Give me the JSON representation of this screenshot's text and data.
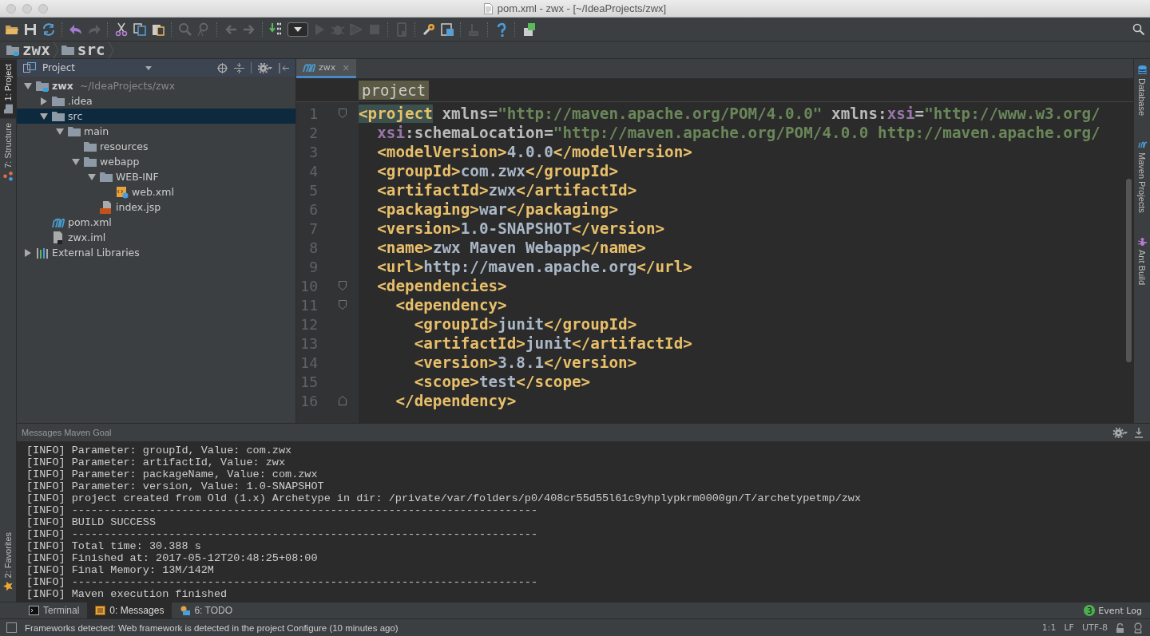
{
  "window": {
    "title": "pom.xml - zwx - [~/IdeaProjects/zwx]"
  },
  "toolbar": [
    [
      {
        "kind": "open",
        "disabled": false
      },
      {
        "kind": "save",
        "disabled": false
      },
      {
        "kind": "sync",
        "disabled": false
      }
    ],
    [
      {
        "kind": "undo",
        "disabled": false
      },
      {
        "kind": "redo",
        "disabled": true
      }
    ],
    [
      {
        "kind": "cut",
        "disabled": false
      },
      {
        "kind": "copy",
        "disabled": false
      },
      {
        "kind": "paste",
        "disabled": false
      }
    ],
    [
      {
        "kind": "find",
        "disabled": true
      },
      {
        "kind": "replace",
        "disabled": true
      }
    ],
    [
      {
        "kind": "back",
        "disabled": true
      },
      {
        "kind": "forward",
        "disabled": true
      }
    ],
    [
      {
        "kind": "build",
        "disabled": false
      },
      {
        "kind": "config",
        "disabled": false
      },
      {
        "kind": "run",
        "disabled": true
      },
      {
        "kind": "debug",
        "disabled": true
      },
      {
        "kind": "coverage",
        "disabled": true
      },
      {
        "kind": "stop",
        "disabled": true
      }
    ],
    [
      {
        "kind": "device",
        "disabled": true
      }
    ],
    [
      {
        "kind": "settings",
        "disabled": false
      },
      {
        "kind": "structure",
        "disabled": false
      }
    ],
    [
      {
        "kind": "sdk",
        "disabled": true
      }
    ],
    [
      {
        "kind": "help",
        "disabled": false
      }
    ],
    [
      {
        "kind": "plugin",
        "disabled": false
      }
    ]
  ],
  "breadcrumb": [
    {
      "label": "zwx",
      "kind": "module"
    },
    {
      "label": "src",
      "kind": "folder"
    }
  ],
  "left_tabs": [
    {
      "label": "1: Project",
      "selected": true
    },
    {
      "label": "7: Structure",
      "selected": false
    }
  ],
  "favorites_tab": {
    "label": "2: Favorites",
    "selected": false
  },
  "project_panel": {
    "title": "Project",
    "tree": [
      {
        "label": "zwx",
        "hint": "~/IdeaProjects/zwx",
        "kind": "module",
        "selected": false,
        "expanded": true,
        "children": [
          {
            "label": ".idea",
            "kind": "folder",
            "selected": false,
            "expanded": false
          },
          {
            "label": "src",
            "kind": "folder",
            "selected": true,
            "expanded": true,
            "children": [
              {
                "label": "main",
                "kind": "folder",
                "selected": false,
                "expanded": true,
                "children": [
                  {
                    "label": "resources",
                    "kind": "folder",
                    "selected": false
                  },
                  {
                    "label": "webapp",
                    "kind": "folder",
                    "selected": false,
                    "expanded": true,
                    "children": [
                      {
                        "label": "WEB-INF",
                        "kind": "folder",
                        "selected": false,
                        "expanded": true,
                        "children": [
                          {
                            "label": "web.xml",
                            "kind": "xml",
                            "selected": false
                          }
                        ]
                      },
                      {
                        "label": "index.jsp",
                        "kind": "jsp",
                        "selected": false
                      }
                    ]
                  }
                ]
              }
            ]
          },
          {
            "label": "pom.xml",
            "kind": "maven",
            "selected": false
          },
          {
            "label": "zwx.iml",
            "kind": "iml",
            "selected": false
          }
        ]
      },
      {
        "label": "External Libraries",
        "kind": "library",
        "selected": false,
        "expanded": false
      }
    ]
  },
  "editor": {
    "tab": {
      "label": "zwx",
      "close": "×",
      "selected": true
    },
    "crumb": "project",
    "lines": [
      {
        "number": "1",
        "fold_start": true,
        "tokens": [
          {
            "kind": "match",
            "text": "<project"
          },
          {
            "kind": "attr",
            "text": " xmlns="
          },
          {
            "kind": "string",
            "text": "\"http://maven.apache.org/POM/4.0.0\""
          },
          {
            "kind": "attr",
            "text": " xmlns:"
          },
          {
            "kind": "ns",
            "text": "xsi"
          },
          {
            "kind": "attr",
            "text": "="
          },
          {
            "kind": "string",
            "text": "\"http://www.w3.org/"
          }
        ]
      },
      {
        "number": "2",
        "tokens": [
          {
            "kind": "ns",
            "text": "  xsi"
          },
          {
            "kind": "attr",
            "text": ":schemaLocation="
          },
          {
            "kind": "string",
            "text": "\"http://maven.apache.org/POM/4.0.0 http://maven.apache.org/"
          }
        ]
      },
      {
        "number": "3",
        "tokens": [
          {
            "kind": "tag",
            "text": "  <modelVersion>"
          },
          {
            "kind": "text",
            "text": "4.0.0"
          },
          {
            "kind": "tag",
            "text": "</modelVersion>"
          }
        ]
      },
      {
        "number": "4",
        "tokens": [
          {
            "kind": "tag",
            "text": "  <groupId>"
          },
          {
            "kind": "text",
            "text": "com.zwx"
          },
          {
            "kind": "tag",
            "text": "</groupId>"
          }
        ]
      },
      {
        "number": "5",
        "tokens": [
          {
            "kind": "tag",
            "text": "  <artifactId>"
          },
          {
            "kind": "text",
            "text": "zwx"
          },
          {
            "kind": "tag",
            "text": "</artifactId>"
          }
        ]
      },
      {
        "number": "6",
        "tokens": [
          {
            "kind": "tag",
            "text": "  <packaging>"
          },
          {
            "kind": "text",
            "text": "war"
          },
          {
            "kind": "tag",
            "text": "</packaging>"
          }
        ]
      },
      {
        "number": "7",
        "tokens": [
          {
            "kind": "tag",
            "text": "  <version>"
          },
          {
            "kind": "text",
            "text": "1.0-SNAPSHOT"
          },
          {
            "kind": "tag",
            "text": "</version>"
          }
        ]
      },
      {
        "number": "8",
        "tokens": [
          {
            "kind": "tag",
            "text": "  <name>"
          },
          {
            "kind": "text",
            "text": "zwx Maven Webapp"
          },
          {
            "kind": "tag",
            "text": "</name>"
          }
        ]
      },
      {
        "number": "9",
        "tokens": [
          {
            "kind": "tag",
            "text": "  <url>"
          },
          {
            "kind": "text",
            "text": "http://maven.apache.org"
          },
          {
            "kind": "tag",
            "text": "</url>"
          }
        ]
      },
      {
        "number": "10",
        "fold_start": true,
        "tokens": [
          {
            "kind": "tag",
            "text": "  <dependencies>"
          }
        ]
      },
      {
        "number": "11",
        "fold_start": true,
        "tokens": [
          {
            "kind": "tag",
            "text": "    <dependency>"
          }
        ]
      },
      {
        "number": "12",
        "tokens": [
          {
            "kind": "tag",
            "text": "      <groupId>"
          },
          {
            "kind": "text",
            "text": "junit"
          },
          {
            "kind": "tag",
            "text": "</groupId>"
          }
        ]
      },
      {
        "number": "13",
        "tokens": [
          {
            "kind": "tag",
            "text": "      <artifactId>"
          },
          {
            "kind": "text",
            "text": "junit"
          },
          {
            "kind": "tag",
            "text": "</artifactId>"
          }
        ]
      },
      {
        "number": "14",
        "tokens": [
          {
            "kind": "tag",
            "text": "      <version>"
          },
          {
            "kind": "text",
            "text": "3.8.1"
          },
          {
            "kind": "tag",
            "text": "</version>"
          }
        ]
      },
      {
        "number": "15",
        "tokens": [
          {
            "kind": "tag",
            "text": "      <scope>"
          },
          {
            "kind": "text",
            "text": "test"
          },
          {
            "kind": "tag",
            "text": "</scope>"
          }
        ]
      },
      {
        "number": "16",
        "fold_end": true,
        "tokens": [
          {
            "kind": "tag",
            "text": "    </dependency>"
          }
        ]
      }
    ]
  },
  "right_tabs": [
    {
      "label": "Database",
      "selected": false
    },
    {
      "label": "Maven Projects",
      "selected": false
    },
    {
      "label": "Ant Build",
      "selected": false
    }
  ],
  "messages": {
    "title": "Messages Maven Goal",
    "lines": [
      "[INFO] Parameter: groupId, Value: com.zwx",
      "[INFO] Parameter: artifactId, Value: zwx",
      "[INFO] Parameter: packageName, Value: com.zwx",
      "[INFO] Parameter: version, Value: 1.0-SNAPSHOT",
      "[INFO] project created from Old (1.x) Archetype in dir: /private/var/folders/p0/408cr55d55l61c9yhplypkrm0000gn/T/archetypetmp/zwx",
      "[INFO] ------------------------------------------------------------------------",
      "[INFO] BUILD SUCCESS",
      "[INFO] ------------------------------------------------------------------------",
      "[INFO] Total time: 30.388 s",
      "[INFO] Finished at: 2017-05-12T20:48:25+08:00",
      "[INFO] Final Memory: 13M/142M",
      "[INFO] ------------------------------------------------------------------------",
      "[INFO] Maven execution finished"
    ]
  },
  "bottom_tabs": [
    {
      "label": "Terminal",
      "kind": "terminal",
      "selected": false
    },
    {
      "label": "0: Messages",
      "kind": "messages",
      "selected": true
    },
    {
      "label": "6: TODO",
      "kind": "todo",
      "selected": false
    }
  ],
  "event_log": {
    "count": "3",
    "label": "Event Log"
  },
  "status_bar": {
    "message": "Frameworks detected: Web framework is detected in the project Configure (10 minutes ago)",
    "position": "1:1",
    "line_separator": "LF",
    "encoding": "UTF-8"
  }
}
